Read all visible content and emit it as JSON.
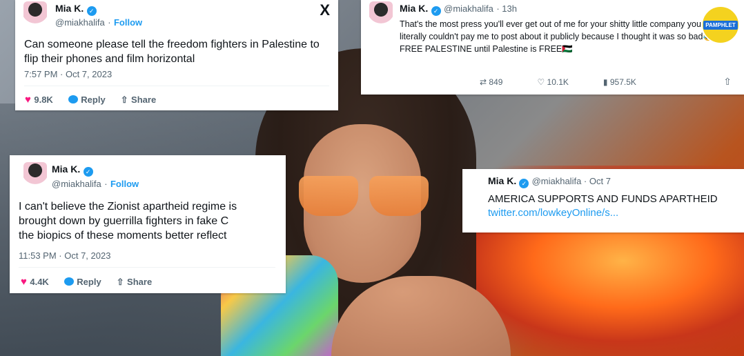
{
  "tweet1": {
    "name": "Mia K.",
    "handle": "@miakhalifa",
    "separator": "·",
    "follow": "Follow",
    "text": "Can someone please tell the freedom fighters in Palestine to flip their phones and film horizontal",
    "timestamp": "7:57 PM · Oct 7, 2023",
    "likes": "9.8K",
    "reply_label": "Reply",
    "share_label": "Share",
    "x_logo": "X"
  },
  "tweet2": {
    "name": "Mia K.",
    "handle": "@miakhalifa",
    "time": "· 13h",
    "text": "That's the most press you'll ever get out of me for your shitty little company you quite literally couldn't pay me to post about it publicly because I thought it was so bad😂 it's FREE PALESTINE until Palestine is FREE🇵🇸",
    "replies": "849",
    "likes": "10.1K",
    "views": "957.5K",
    "badge": "PAMPHLET"
  },
  "tweet3": {
    "name": "Mia K.",
    "handle": "@miakhalifa",
    "separator": "·",
    "follow": "Follow",
    "text": "I can't believe the Zionist apartheid regime is\nbrought down by guerrilla fighters in fake C\nthe biopics of these moments better reflect",
    "timestamp": "11:53 PM · Oct 7, 2023",
    "likes": "4.4K",
    "reply_label": "Reply",
    "share_label": "Share"
  },
  "tweet4": {
    "name": "Mia K.",
    "handle": "@miakhalifa · Oct 7",
    "text": "AMERICA SUPPORTS AND FUNDS APARTHEID",
    "link": "twitter.com/lowkeyOnline/s..."
  }
}
